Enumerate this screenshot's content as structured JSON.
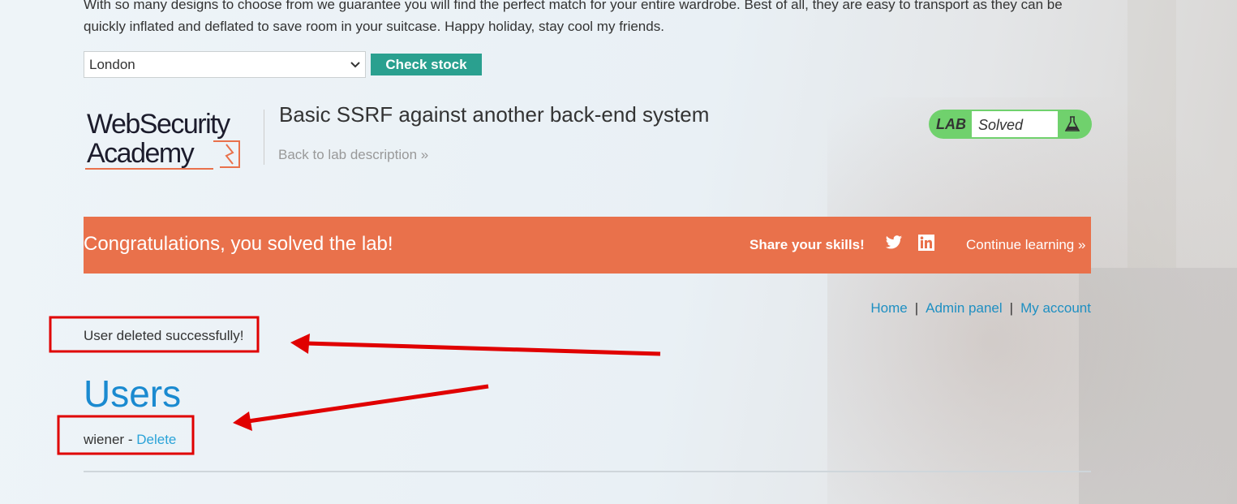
{
  "product": {
    "description": "With so many designs to choose from we guarantee you will find the perfect match for your entire wardrobe. Best of all, they are easy to transport as they can be quickly inflated and deflated to save room in your suitcase. Happy holiday, stay cool my friends."
  },
  "stock": {
    "selected": "London",
    "button": "Check stock"
  },
  "header": {
    "logo_line1": "WebSecurity",
    "logo_line2": "Academy",
    "lab_title": "Basic SSRF against another back-end system",
    "back_link": "Back to lab description »",
    "lab_label": "LAB",
    "lab_status": "Solved"
  },
  "banner": {
    "congrats": "Congratulations, you solved the lab!",
    "share": "Share your skills!",
    "continue": "Continue learning »"
  },
  "nav": {
    "home": "Home",
    "admin": "Admin panel",
    "account": "My account",
    "separator": "|"
  },
  "message": "User deleted successfully!",
  "users": {
    "heading": "Users",
    "list": [
      {
        "name": "wiener",
        "dash": "-",
        "action": "Delete"
      }
    ]
  },
  "colors": {
    "accent_green": "#70d16d",
    "button_teal": "#2aa08f",
    "banner_orange": "#e9714b",
    "link_blue": "#1e8fc2",
    "annotation_red": "#e00000"
  },
  "icons": {
    "select_chevron": "chevron-down-icon",
    "flask": "flask-icon",
    "twitter": "twitter-icon",
    "linkedin": "linkedin-icon"
  }
}
